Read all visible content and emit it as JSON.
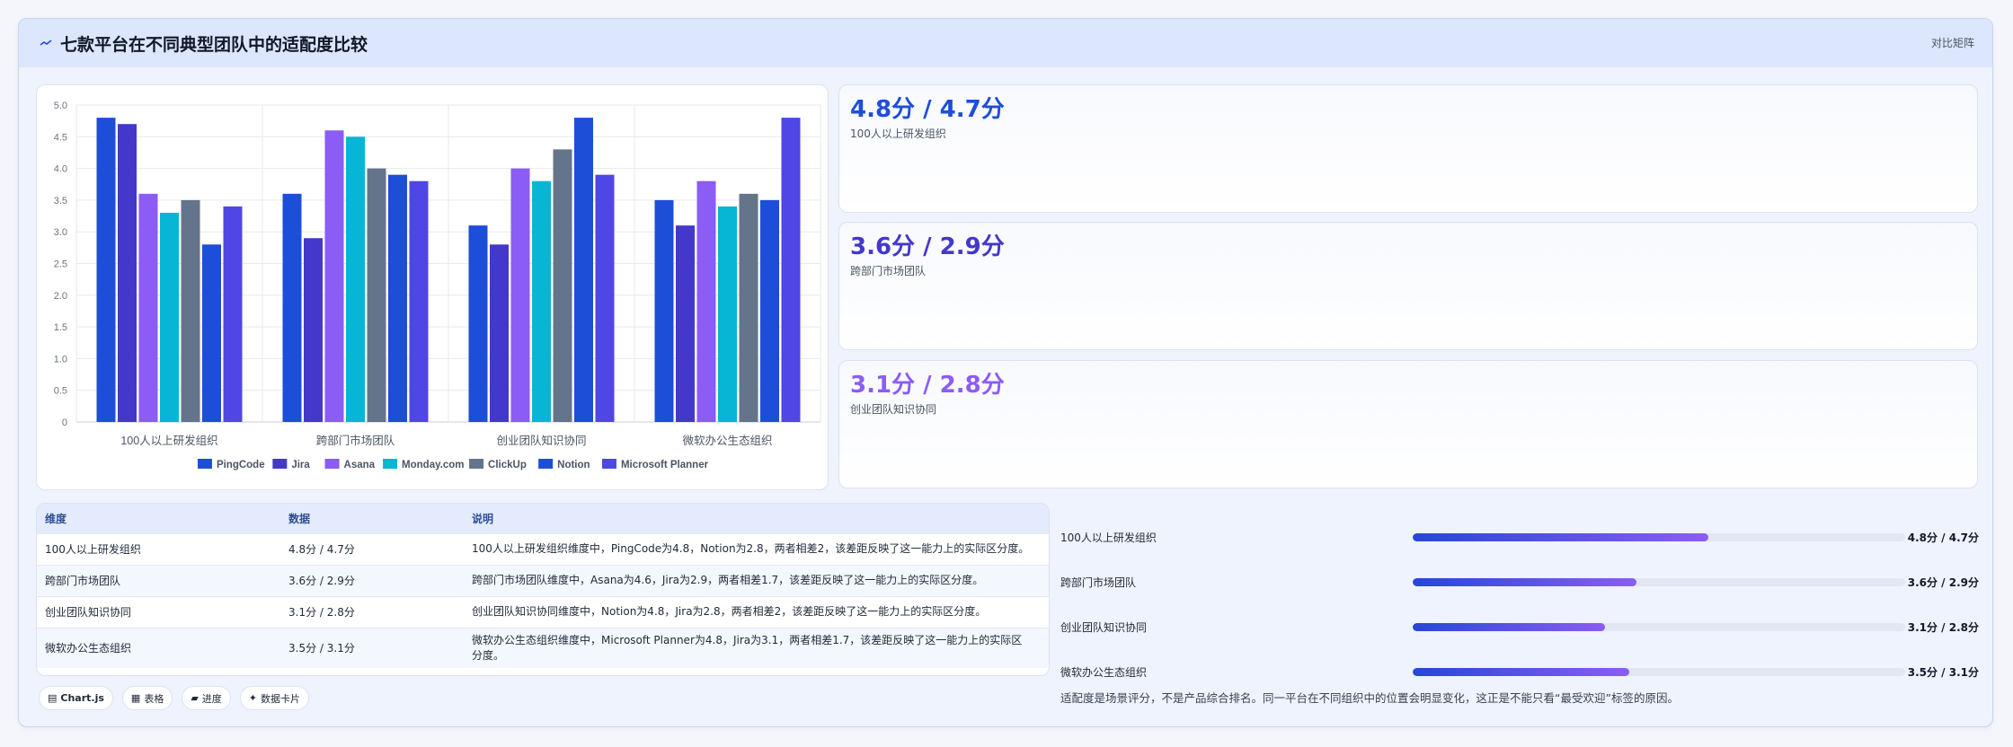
{
  "header": {
    "title": "七款平台在不同典型团队中的适配度比较",
    "tag": "对比矩阵"
  },
  "colors": {
    "PingCode": "#1d4ed8",
    "Jira": "#4338ca",
    "Asana": "#8b5cf6",
    "Monday.com": "#06b6d4",
    "ClickUp": "#64748b",
    "Notion": "#1d4ed8",
    "Microsoft Planner": "#4f46e5",
    "stat1": "#1d4ed8",
    "stat2": "#4338ca",
    "stat3": "#8b5cf6"
  },
  "chart_data": {
    "type": "bar",
    "categories": [
      "100人以上研发组织",
      "跨部门市场团队",
      "创业团队知识协同",
      "微软办公生态组织"
    ],
    "series": [
      {
        "name": "PingCode",
        "values": [
          4.8,
          3.6,
          3.1,
          3.5
        ]
      },
      {
        "name": "Jira",
        "values": [
          4.7,
          2.9,
          2.8,
          3.1
        ]
      },
      {
        "name": "Asana",
        "values": [
          3.6,
          4.6,
          4.0,
          3.8
        ]
      },
      {
        "name": "Monday.com",
        "values": [
          3.3,
          4.5,
          3.8,
          3.4
        ]
      },
      {
        "name": "ClickUp",
        "values": [
          3.5,
          4.0,
          4.3,
          3.6
        ]
      },
      {
        "name": "Notion",
        "values": [
          2.8,
          3.9,
          4.8,
          3.5
        ]
      },
      {
        "name": "Microsoft Planner",
        "values": [
          3.4,
          3.8,
          3.9,
          4.8
        ]
      }
    ],
    "ylim": [
      0,
      5
    ],
    "yticks": [
      "5.0",
      "4.5",
      "4.0",
      "3.5",
      "3.0",
      "2.5",
      "2.0",
      "1.5",
      "1.0",
      "0.5",
      "0"
    ],
    "grid": true,
    "legend": "bottom"
  },
  "stats": [
    {
      "value": "4.8分 / 4.7分",
      "label": "100人以上研发组织"
    },
    {
      "value": "3.6分 / 2.9分",
      "label": "跨部门市场团队"
    },
    {
      "value": "3.1分 / 2.8分",
      "label": "创业团队知识协同"
    }
  ],
  "table": {
    "headers": [
      "维度",
      "数据",
      "说明"
    ],
    "rows": [
      [
        "100人以上研发组织",
        "4.8分 / 4.7分",
        "100人以上研发组织维度中，PingCode为4.8，Notion为2.8，两者相差2，该差距反映了这一能力上的实际区分度。"
      ],
      [
        "跨部门市场团队",
        "3.6分 / 2.9分",
        "跨部门市场团队维度中，Asana为4.6，Jira为2.9，两者相差1.7，该差距反映了这一能力上的实际区分度。"
      ],
      [
        "创业团队知识协同",
        "3.1分 / 2.8分",
        "创业团队知识协同维度中，Notion为4.8，Jira为2.8，两者相差2，该差距反映了这一能力上的实际区分度。"
      ],
      [
        "微软办公生态组织",
        "3.5分 / 3.1分",
        "微软办公生态组织维度中，Microsoft Planner为4.8，Jira为3.1，两者相差1.7，该差距反映了这一能力上的实际区分度。"
      ]
    ]
  },
  "chips": [
    {
      "icon": "▤",
      "label": "Chart.js",
      "icon_name": "chart-icon"
    },
    {
      "icon": "▦",
      "label": "表格",
      "icon_name": "table-icon"
    },
    {
      "icon": "▰",
      "label": "进度",
      "icon_name": "progress-icon"
    },
    {
      "icon": "✦",
      "label": "数据卡片",
      "icon_name": "sparkle-icon"
    }
  ],
  "progress": [
    {
      "label": "100人以上研发组织",
      "value": "4.8分 / 4.7分",
      "fill": 0.6
    },
    {
      "label": "跨部门市场团队",
      "value": "3.6分 / 2.9分",
      "fill": 0.455
    },
    {
      "label": "创业团队知识协同",
      "value": "3.1分 / 2.8分",
      "fill": 0.39
    },
    {
      "label": "微软办公生态组织",
      "value": "3.5分 / 3.1分",
      "fill": 0.44
    }
  ],
  "footnote": "适配度是场景评分，不是产品综合排名。同一平台在不同组织中的位置会明显变化，这正是不能只看“最受欢迎”标签的原因。"
}
